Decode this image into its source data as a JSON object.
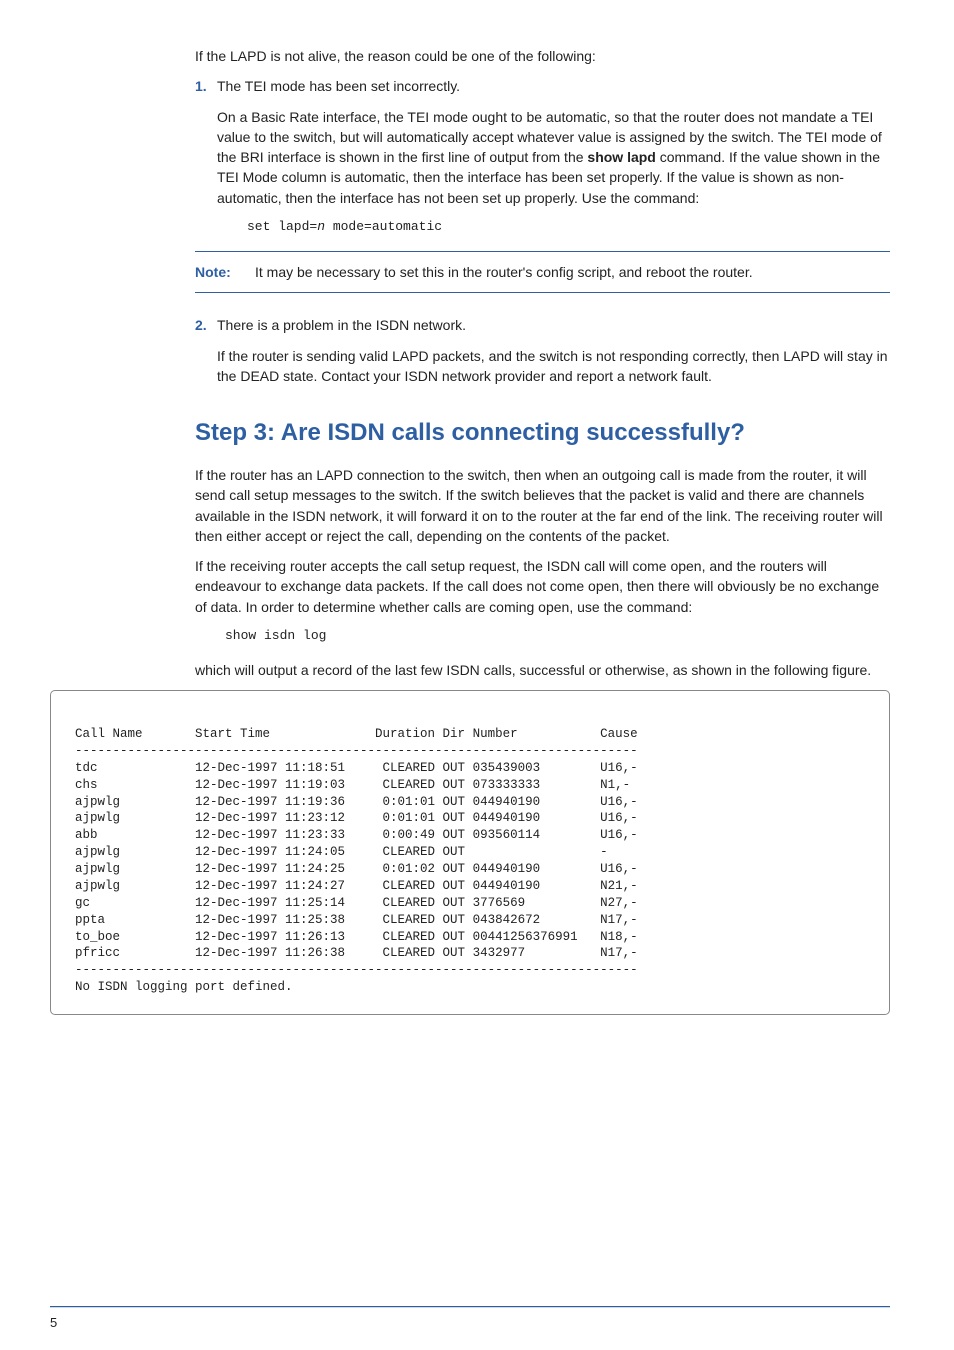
{
  "intro": "If the LAPD is not alive, the reason could be one of the following:",
  "items": [
    {
      "num": "1.",
      "title": "The TEI mode has been set incorrectly.",
      "body_pre": "On a Basic Rate interface, the TEI mode ought to be automatic, so that the router does not mandate a TEI value to the switch, but will automatically accept whatever value is assigned by the switch. The TEI mode of the BRI interface is shown in the first line of output from the ",
      "body_bold": "show lapd",
      "body_post": " command. If the value shown in the TEI Mode column is automatic, then the interface has been set properly. If the value is shown as non-automatic, then the interface has not been set up properly. Use the command:",
      "code_pre": "set lapd=",
      "code_italic": "n",
      "code_post": " mode=automatic"
    },
    {
      "num": "2.",
      "title": "There is a problem in the ISDN network.",
      "body": "If the router is sending valid LAPD packets, and the switch is not responding correctly, then LAPD will stay in the DEAD state. Contact your ISDN network provider and report a network fault."
    }
  ],
  "note": {
    "label": "Note:",
    "text": "It may be necessary to set this in the router's config script, and reboot the router."
  },
  "step_heading": "Step 3: Are ISDN calls connecting successfully?",
  "para1": "If the router has an LAPD connection to the switch, then when an outgoing call is made from the router, it will send call setup messages to the switch. If the switch believes that the packet is valid and there are channels available in the ISDN network, it will forward it on to the router at the far end of the link. The receiving router will then either accept or reject the call, depending on the contents of the packet.",
  "para2": "If the receiving router accepts the call setup request, the ISDN call will come open, and the routers will endeavour to exchange data packets. If the call does not come open, then there will obviously be no exchange of data. In order to determine whether calls are coming open, use the command:",
  "cmd2": "show isdn log",
  "para3": "which will output a record of the last few ISDN calls, successful or otherwise, as shown in the following figure.",
  "isdn_log": {
    "header": "Call Name       Start Time              Duration Dir Number           Cause",
    "sep": "---------------------------------------------------------------------------",
    "rows": [
      "tdc             12-Dec-1997 11:18:51     CLEARED OUT 035439003        U16,-",
      "chs             12-Dec-1997 11:19:03     CLEARED OUT 073333333        N1,-",
      "ajpwlg          12-Dec-1997 11:19:36     0:01:01 OUT 044940190        U16,-",
      "ajpwlg          12-Dec-1997 11:23:12     0:01:01 OUT 044940190        U16,-",
      "abb             12-Dec-1997 11:23:33     0:00:49 OUT 093560114        U16,-",
      "ajpwlg          12-Dec-1997 11:24:05     CLEARED OUT                  -",
      "ajpwlg          12-Dec-1997 11:24:25     0:01:02 OUT 044940190        U16,-",
      "ajpwlg          12-Dec-1997 11:24:27     CLEARED OUT 044940190        N21,-",
      "gc              12-Dec-1997 11:25:14     CLEARED OUT 3776569          N27,-",
      "ppta            12-Dec-1997 11:25:38     CLEARED OUT 043842672        N17,-",
      "to_boe          12-Dec-1997 11:26:13     CLEARED OUT 00441256376991   N18,-",
      "pfricc          12-Dec-1997 11:26:38     CLEARED OUT 3432977          N17,-"
    ],
    "footer": "No ISDN logging port defined."
  },
  "page_num": "5"
}
